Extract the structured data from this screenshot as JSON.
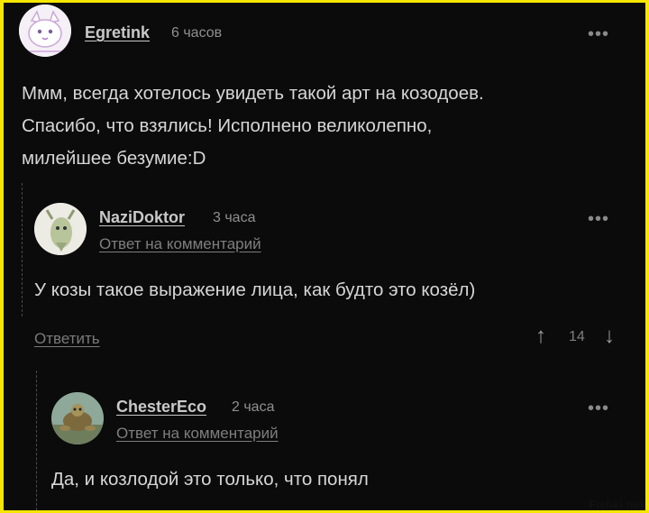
{
  "comment1": {
    "username": "Egretink",
    "time": "6 часов",
    "more_icon": "•••",
    "lines": [
      "Ммм, всегда хотелось увидеть такой арт на козодоев.",
      "Спасибо, что взялись! Исполнено великолепно,",
      "милейшее безумие:D"
    ]
  },
  "comment2": {
    "username": "NaziDoktor",
    "time": "3 часа",
    "more_icon": "•••",
    "reply_to": "Ответ на комментарий",
    "text": "У козы такое выражение лица, как будто это козёл)",
    "reply_button": "Ответить",
    "upvote_icon": "↑",
    "score": "14",
    "downvote_icon": "↓"
  },
  "comment3": {
    "username": "ChesterEco",
    "time": "2 часа",
    "more_icon": "•••",
    "reply_to": "Ответ на комментарий",
    "text": "Да, и козлодой это только, что понял"
  },
  "watermark": "Fishki.net",
  "colors": {
    "background": "#0b0b0b",
    "frame": "#f7e600",
    "text": "#d6d6d6"
  }
}
